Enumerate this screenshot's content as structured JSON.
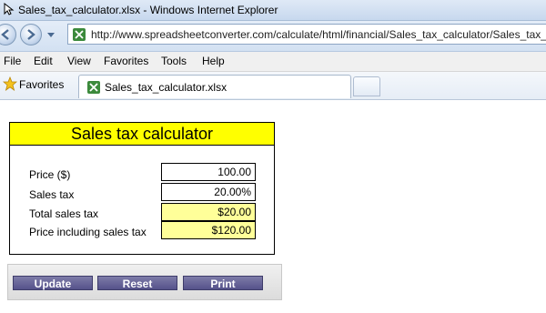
{
  "window": {
    "title": "Sales_tax_calculator.xlsx - Windows Internet Explorer"
  },
  "address_bar": {
    "url": "http://www.spreadsheetconverter.com/calculate/html/financial/Sales_tax_calculator/Sales_tax_"
  },
  "menu": {
    "items": [
      "File",
      "Edit",
      "View",
      "Favorites",
      "Tools",
      "Help"
    ]
  },
  "favorites_bar": {
    "favorites_label": "Favorites",
    "tab_label": "Sales_tax_calculator.xlsx"
  },
  "calculator": {
    "title": "Sales tax calculator",
    "rows": [
      {
        "label": "Price ($)",
        "value": "100.00",
        "kind": "input"
      },
      {
        "label": "Sales tax",
        "value": "20.00%",
        "kind": "input"
      },
      {
        "label": "Total sales tax",
        "value": "$20.00",
        "kind": "output"
      },
      {
        "label": "Price including sales tax",
        "value": "$120.00",
        "kind": "output"
      }
    ]
  },
  "buttons": {
    "update": "Update",
    "reset": "Reset",
    "print": "Print"
  },
  "colors": {
    "title_bg": "#ffff00",
    "output_bg": "#ffff99",
    "button_bg": "#6a6799"
  }
}
